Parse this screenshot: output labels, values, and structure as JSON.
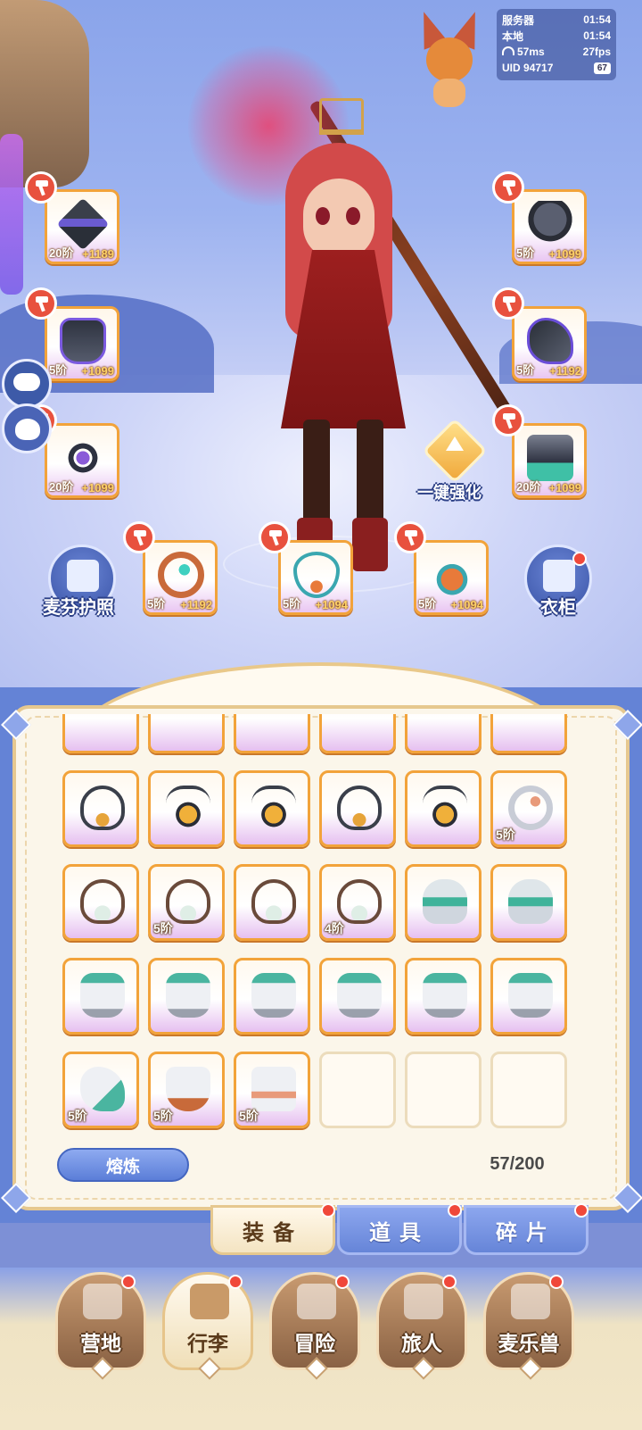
{
  "hud": {
    "server_label": "服务器",
    "server_time": "01:54",
    "local_label": "本地",
    "local_time": "01:54",
    "ping": "57ms",
    "fps": "27fps",
    "uid_label": "UID",
    "uid": "94717",
    "battery": "67"
  },
  "equipped": [
    {
      "slot": "weapon",
      "icon": "staff-icon",
      "tier": "20阶",
      "plus": "+1189"
    },
    {
      "slot": "helmet",
      "icon": "helmet-icon",
      "tier": "5阶",
      "plus": "+1099"
    },
    {
      "slot": "armor",
      "icon": "chest-armor-icon",
      "tier": "5阶",
      "plus": "+1099"
    },
    {
      "slot": "gloves",
      "icon": "gauntlet-icon",
      "tier": "5阶",
      "plus": "+1192"
    },
    {
      "slot": "belt",
      "icon": "belt-icon",
      "tier": "20阶",
      "plus": "+1099"
    },
    {
      "slot": "boots",
      "icon": "boots-icon",
      "tier": "20阶",
      "plus": "+1099"
    },
    {
      "slot": "ring",
      "icon": "ring-icon",
      "tier": "5阶",
      "plus": "+1192"
    },
    {
      "slot": "necklace",
      "icon": "necklace-icon",
      "tier": "5阶",
      "plus": "+1094"
    },
    {
      "slot": "amulet",
      "icon": "amulet-icon",
      "tier": "5阶",
      "plus": "+1094"
    }
  ],
  "buttons": {
    "passport": "麦芬护照",
    "wardrobe": "衣柜",
    "one_key_enhance": "一键强化",
    "smelt": "熔炼"
  },
  "inventory": {
    "capacity": "57/200",
    "rows": [
      [
        {
          "icon": "it-neck-dark",
          "tier": ""
        },
        {
          "icon": "it-neck-gold",
          "tier": ""
        },
        {
          "icon": "it-neck-gold",
          "tier": ""
        },
        {
          "icon": "it-neck-dark",
          "tier": ""
        },
        {
          "icon": "it-neck-gold",
          "tier": ""
        },
        {
          "icon": "it-ring-white",
          "tier": "5阶"
        }
      ],
      [
        {
          "icon": "it-neck-brown",
          "tier": ""
        },
        {
          "icon": "it-neck-brown",
          "tier": "5阶"
        },
        {
          "icon": "it-neck-brown",
          "tier": ""
        },
        {
          "icon": "it-neck-brown",
          "tier": "4阶"
        },
        {
          "icon": "it-helm-green",
          "tier": ""
        },
        {
          "icon": "it-helm-green",
          "tier": ""
        }
      ],
      [
        {
          "icon": "it-armor-white",
          "tier": ""
        },
        {
          "icon": "it-armor-white",
          "tier": ""
        },
        {
          "icon": "it-armor-white",
          "tier": ""
        },
        {
          "icon": "it-armor-white",
          "tier": ""
        },
        {
          "icon": "it-armor-white",
          "tier": ""
        },
        {
          "icon": "it-armor-white",
          "tier": ""
        }
      ],
      [
        {
          "icon": "it-glove-white",
          "tier": "5阶"
        },
        {
          "icon": "it-chest-white",
          "tier": "5阶"
        },
        {
          "icon": "it-boots-white",
          "tier": "5阶"
        },
        {
          "icon": "",
          "tier": ""
        },
        {
          "icon": "",
          "tier": ""
        },
        {
          "icon": "",
          "tier": ""
        }
      ]
    ]
  },
  "category_tabs": [
    {
      "label": "装备",
      "active": true
    },
    {
      "label": "道具",
      "active": false
    },
    {
      "label": "碎片",
      "active": false
    }
  ],
  "nav": [
    {
      "label": "营地",
      "icon": "castle-icon",
      "active": false
    },
    {
      "label": "行李",
      "icon": "chest-icon",
      "active": true
    },
    {
      "label": "冒险",
      "icon": "crossed-swords-icon",
      "active": false
    },
    {
      "label": "旅人",
      "icon": "traveler-icon",
      "active": false
    },
    {
      "label": "麦乐兽",
      "icon": "pet-icon",
      "active": false
    }
  ]
}
